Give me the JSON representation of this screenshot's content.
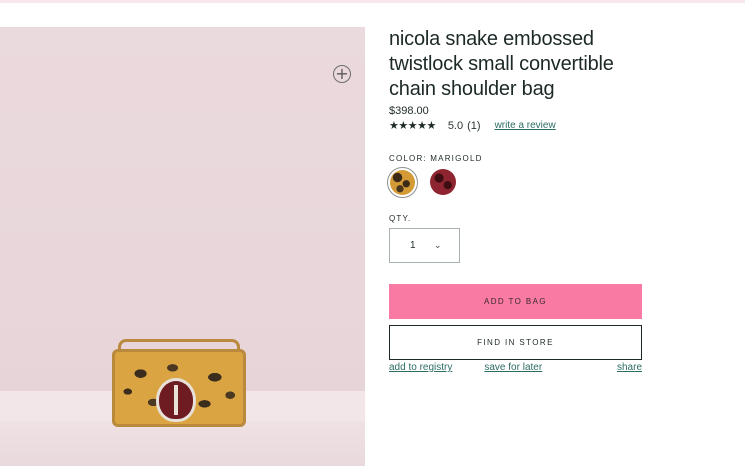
{
  "product": {
    "title": "nicola snake embossed twistlock small convertible chain shoulder bag",
    "price": "$398.00",
    "rating": {
      "stars": "★★★★★",
      "value": "5.0",
      "count": "(1)",
      "write_review": "write a review"
    },
    "color": {
      "label": "COLOR: MARIGOLD",
      "swatches": [
        "marigold",
        "red"
      ]
    },
    "quantity": {
      "label": "QTY.",
      "value": "1",
      "chevron": "⌄"
    },
    "buttons": {
      "add_to_bag": "ADD TO BAG",
      "find_in_store": "FIND IN STORE"
    },
    "links": {
      "registry": "add to registry",
      "save": "save for later",
      "share": "share"
    },
    "zoom_symbol": "+"
  },
  "colors": {
    "accent_pink": "#f97aa3",
    "link": "#2d6c63",
    "text": "#1d2927"
  },
  "icons": {
    "zoom": "zoom-plus-icon",
    "stars": "star-icon",
    "chevron": "chevron-down-icon"
  }
}
